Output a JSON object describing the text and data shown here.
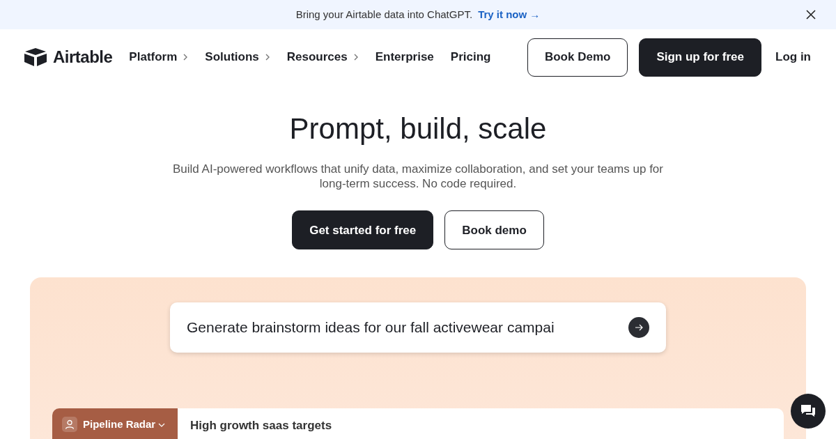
{
  "banner": {
    "text": "Bring your Airtable data into ChatGPT.",
    "link": "Try it now",
    "link_arrow": "→"
  },
  "header": {
    "logo": "Airtable",
    "nav": [
      {
        "label": "Platform",
        "has_menu": true
      },
      {
        "label": "Solutions",
        "has_menu": true
      },
      {
        "label": "Resources",
        "has_menu": true
      },
      {
        "label": "Enterprise",
        "has_menu": false
      },
      {
        "label": "Pricing",
        "has_menu": false
      }
    ],
    "buttons": [
      {
        "label": "Book Demo",
        "kind": "outline"
      },
      {
        "label": "Sign up for free",
        "kind": "solid"
      },
      {
        "label": "Log in",
        "kind": "link"
      }
    ]
  },
  "hero": {
    "title": "Prompt, build, scale",
    "subtitle": "Build AI-powered workflows that unify data, maximize collaboration, and set your teams up for long-term success. No code required.",
    "buttons": [
      {
        "label": "Get started for free",
        "kind": "solid"
      },
      {
        "label": "Book demo",
        "kind": "outline"
      }
    ]
  },
  "prompt": {
    "value": "Generate brainstorm ideas for our fall activewear campai"
  },
  "app_preview": {
    "workspace": "Pipeline Radar",
    "view_title": "High growth saas targets"
  }
}
